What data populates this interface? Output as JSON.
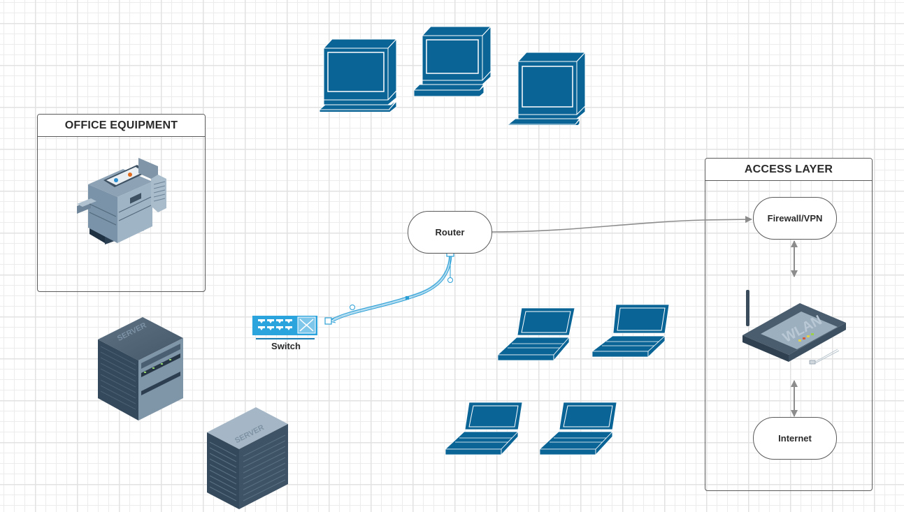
{
  "diagram": {
    "containers": {
      "office": {
        "title": "OFFICE EQUIPMENT"
      },
      "access": {
        "title": "ACCESS LAYER"
      }
    },
    "nodes": {
      "router": {
        "label": "Router"
      },
      "firewall": {
        "label": "Firewall/VPN"
      },
      "internet": {
        "label": "Internet"
      },
      "switch": {
        "label": "Switch"
      }
    },
    "devices": {
      "desktops": 3,
      "laptops": 4,
      "servers": [
        {
          "label": "SERVER",
          "style": "rack"
        },
        {
          "label": "SERVER",
          "style": "tower"
        }
      ],
      "printer": "multifunction-copier",
      "wireless_router": {
        "label": "WLAN"
      }
    },
    "connections": [
      {
        "from": "router",
        "to": "firewall",
        "style": "gray-arrow"
      },
      {
        "from": "router",
        "to": "switch",
        "style": "selected-curve"
      },
      {
        "from": "firewall",
        "to": "wireless_router",
        "style": "bidirectional"
      },
      {
        "from": "wireless_router",
        "to": "internet",
        "style": "bidirectional"
      }
    ],
    "colors": {
      "device_blue": "#0a6496",
      "switch_blue": "#2ba3dc",
      "selection_blue": "#2a9fd6",
      "connector_gray": "#8c8c8c",
      "border": "#5a5a5a",
      "server_dark": "#3a4c5c",
      "server_light": "#8da3b5"
    }
  }
}
